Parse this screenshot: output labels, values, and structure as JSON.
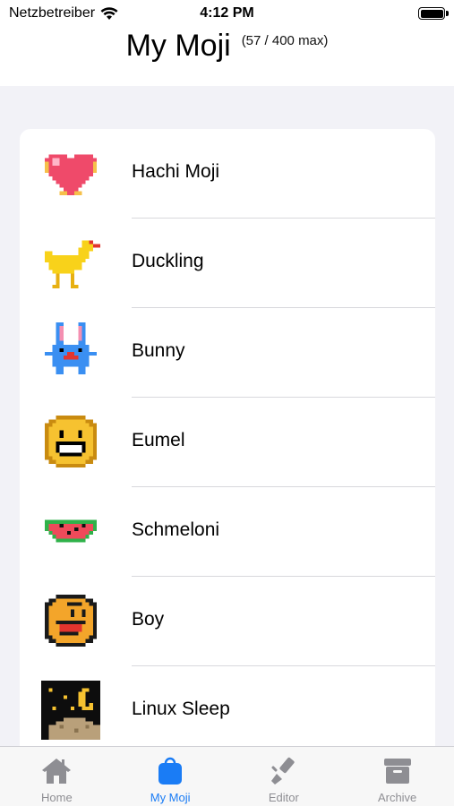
{
  "status_bar": {
    "carrier": "Netzbetreiber",
    "time": "4:12 PM",
    "battery_level": 1.0
  },
  "header": {
    "title": "My Moji",
    "subtitle": "(57 / 400 max)"
  },
  "moji_list": [
    {
      "label": "Hachi Moji",
      "icon": "pixel-heart-icon"
    },
    {
      "label": "Duckling",
      "icon": "pixel-duckling-icon"
    },
    {
      "label": "Bunny",
      "icon": "pixel-bunny-icon"
    },
    {
      "label": "Eumel",
      "icon": "pixel-smiley-icon"
    },
    {
      "label": "Schmeloni",
      "icon": "pixel-watermelon-icon"
    },
    {
      "label": "Boy",
      "icon": "pixel-boy-face-icon"
    },
    {
      "label": "Linux Sleep",
      "icon": "pixel-night-moon-icon"
    }
  ],
  "tab_bar": {
    "tabs": [
      {
        "label": "Home",
        "icon": "house-icon",
        "active": false
      },
      {
        "label": "My Moji",
        "icon": "bag-icon",
        "active": true
      },
      {
        "label": "Editor",
        "icon": "brush-icon",
        "active": false
      },
      {
        "label": "Archive",
        "icon": "archive-box-icon",
        "active": false
      }
    ],
    "active_color": "#1a7cf5",
    "inactive_color": "#8e8e93"
  }
}
